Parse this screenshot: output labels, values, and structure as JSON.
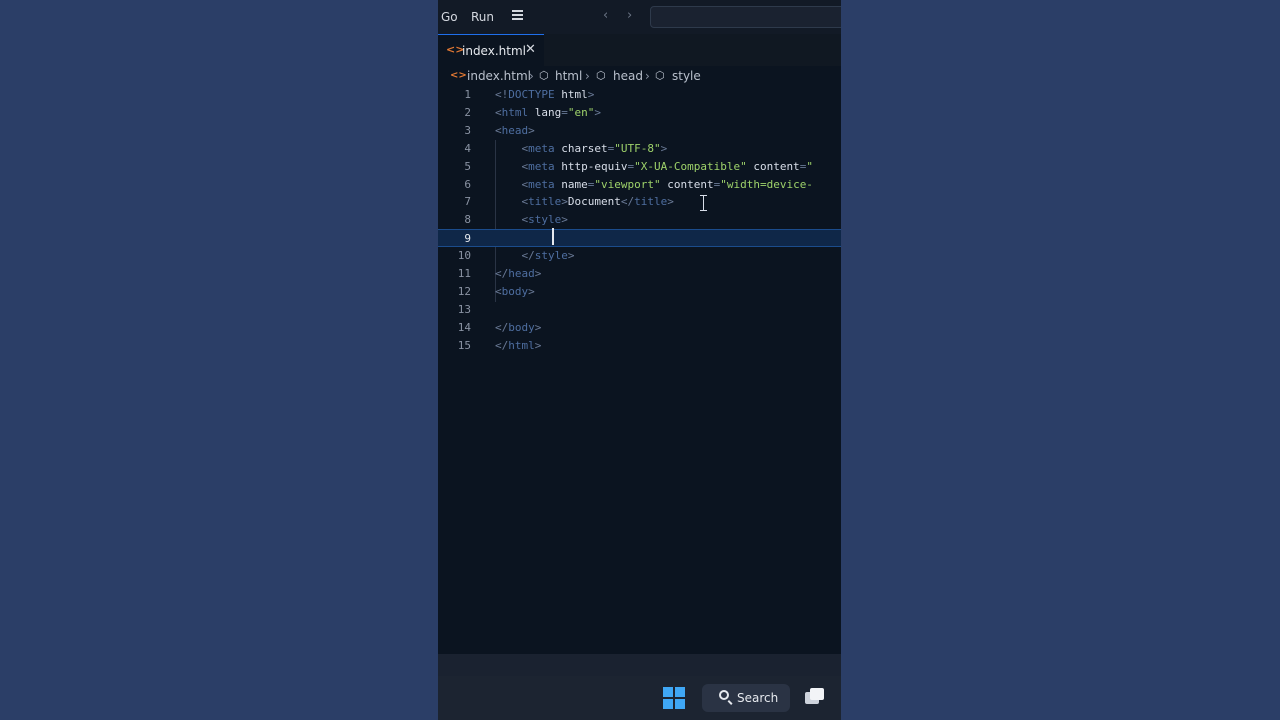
{
  "menubar": {
    "items": [
      "Go",
      "Run"
    ],
    "hamburger_icon": "hamburger-menu-icon",
    "back_icon": "chevron-left-icon",
    "forward_icon": "chevron-right-icon",
    "search_value": ""
  },
  "tab": {
    "label": "index.html",
    "icon": "html-file-icon",
    "close_glyph": "✕"
  },
  "breadcrumb": {
    "file": "index.html",
    "symbols": [
      "html",
      "head",
      "style"
    ]
  },
  "editor": {
    "current_line": 9,
    "lines": [
      {
        "n": "1",
        "tokens": [
          [
            "p",
            "<!"
          ],
          [
            "g",
            "DOCTYPE"
          ],
          [
            "a",
            " html"
          ],
          [
            "p",
            ">"
          ]
        ]
      },
      {
        "n": "2",
        "tokens": [
          [
            "p",
            "<"
          ],
          [
            "g",
            "html"
          ],
          [
            "a",
            " lang"
          ],
          [
            "p",
            "="
          ],
          [
            "s",
            "\"en\""
          ],
          [
            "p",
            ">"
          ]
        ]
      },
      {
        "n": "3",
        "tokens": [
          [
            "p",
            "<"
          ],
          [
            "g",
            "head"
          ],
          [
            "p",
            ">"
          ]
        ]
      },
      {
        "n": "4",
        "tokens": [
          [
            "a",
            "    "
          ],
          [
            "p",
            "<"
          ],
          [
            "g",
            "meta"
          ],
          [
            "a",
            " charset"
          ],
          [
            "p",
            "="
          ],
          [
            "s",
            "\"UTF-8\""
          ],
          [
            "p",
            ">"
          ]
        ]
      },
      {
        "n": "5",
        "tokens": [
          [
            "a",
            "    "
          ],
          [
            "p",
            "<"
          ],
          [
            "g",
            "meta"
          ],
          [
            "a",
            " http-equiv"
          ],
          [
            "p",
            "="
          ],
          [
            "s",
            "\"X-UA-Compatible\""
          ],
          [
            "a",
            " content"
          ],
          [
            "p",
            "="
          ],
          [
            "s",
            "\""
          ]
        ]
      },
      {
        "n": "6",
        "tokens": [
          [
            "a",
            "    "
          ],
          [
            "p",
            "<"
          ],
          [
            "g",
            "meta"
          ],
          [
            "a",
            " name"
          ],
          [
            "p",
            "="
          ],
          [
            "s",
            "\"viewport\""
          ],
          [
            "a",
            " content"
          ],
          [
            "p",
            "="
          ],
          [
            "s",
            "\"width=device-"
          ]
        ]
      },
      {
        "n": "7",
        "tokens": [
          [
            "a",
            "    "
          ],
          [
            "p",
            "<"
          ],
          [
            "g",
            "title"
          ],
          [
            "p",
            ">"
          ],
          [
            "t",
            "Document"
          ],
          [
            "p",
            "</"
          ],
          [
            "g",
            "title"
          ],
          [
            "p",
            ">"
          ]
        ]
      },
      {
        "n": "8",
        "tokens": [
          [
            "a",
            "    "
          ],
          [
            "p",
            "<"
          ],
          [
            "g",
            "style"
          ],
          [
            "p",
            ">"
          ]
        ]
      },
      {
        "n": "9",
        "tokens": [
          [
            "a",
            "        "
          ]
        ]
      },
      {
        "n": "10",
        "tokens": [
          [
            "a",
            "    "
          ],
          [
            "p",
            "</"
          ],
          [
            "g",
            "style"
          ],
          [
            "p",
            ">"
          ]
        ]
      },
      {
        "n": "11",
        "tokens": [
          [
            "p",
            "</"
          ],
          [
            "g",
            "head"
          ],
          [
            "p",
            ">"
          ]
        ]
      },
      {
        "n": "12",
        "tokens": [
          [
            "p",
            "<"
          ],
          [
            "g",
            "body"
          ],
          [
            "p",
            ">"
          ]
        ]
      },
      {
        "n": "13",
        "tokens": []
      },
      {
        "n": "14",
        "tokens": [
          [
            "p",
            "</"
          ],
          [
            "g",
            "body"
          ],
          [
            "p",
            ">"
          ]
        ]
      },
      {
        "n": "15",
        "tokens": [
          [
            "p",
            "</"
          ],
          [
            "g",
            "html"
          ],
          [
            "p",
            ">"
          ]
        ]
      }
    ]
  },
  "taskbar": {
    "start_icon": "windows-logo-icon",
    "search_label": "Search",
    "search_icon": "search-icon",
    "task_view_icon": "task-view-icon"
  },
  "colors": {
    "background": "#2b3e67",
    "editor_bg": "#0b1420",
    "tag": "#4e6ea0",
    "string": "#9ed26a",
    "file_icon": "#e37933",
    "current_line": "#0f2748"
  }
}
